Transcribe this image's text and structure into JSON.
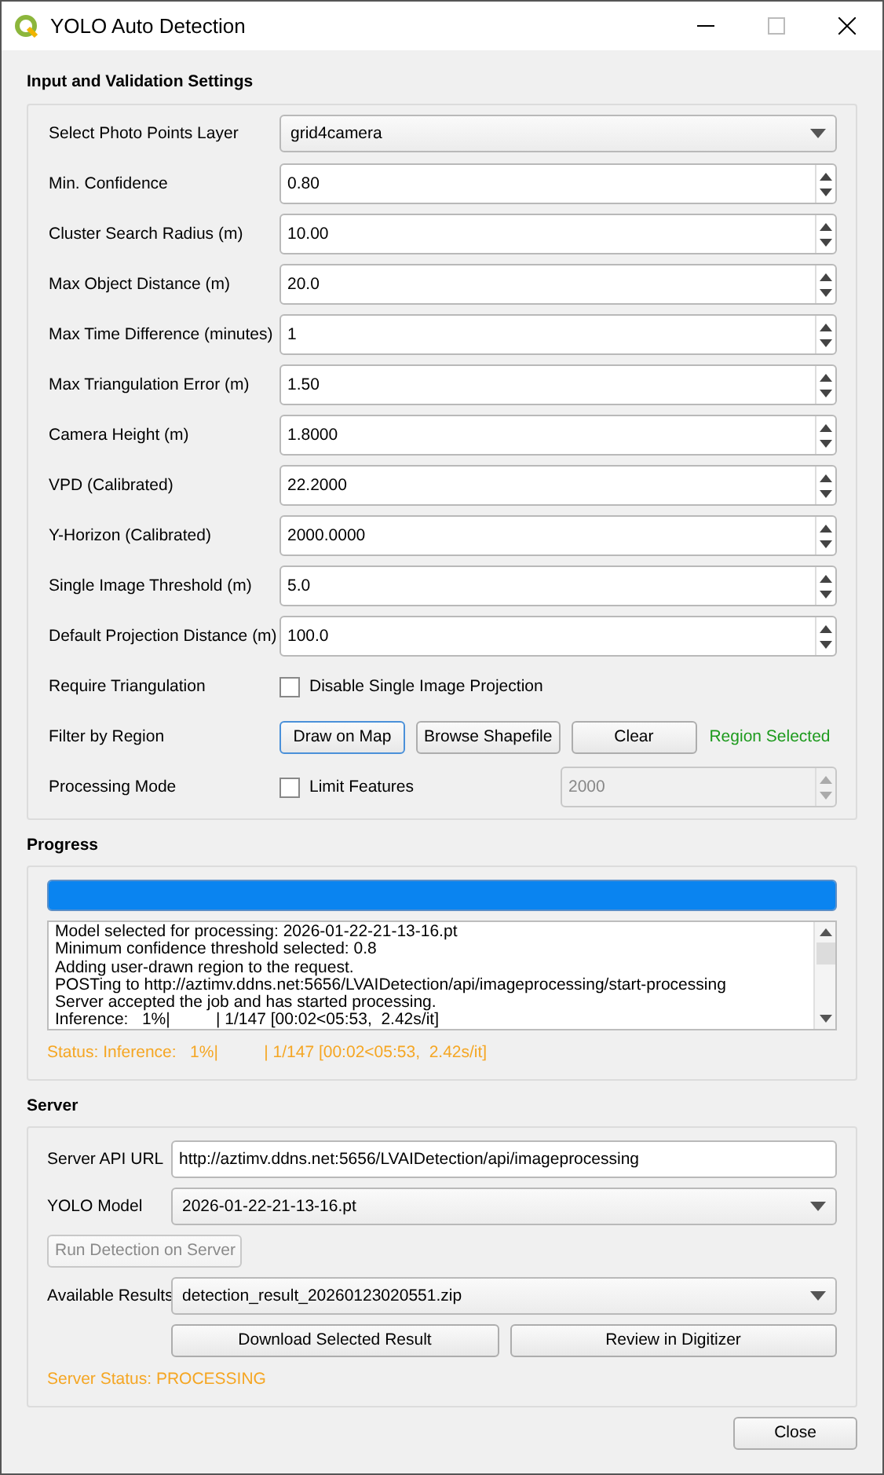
{
  "window": {
    "title": "YOLO Auto Detection"
  },
  "settings": {
    "heading": "Input and Validation Settings",
    "rows": [
      {
        "kind": "combo",
        "label": "Select Photo Points Layer",
        "value": "grid4camera"
      },
      {
        "kind": "spin",
        "label": "Min. Confidence",
        "value": "0.80"
      },
      {
        "kind": "spin",
        "label": "Cluster Search Radius (m)",
        "value": "10.00"
      },
      {
        "kind": "spin",
        "label": "Max Object Distance (m)",
        "value": "20.0"
      },
      {
        "kind": "spin",
        "label": "Max Time Difference (minutes)",
        "value": "1"
      },
      {
        "kind": "spin",
        "label": "Max Triangulation Error (m)",
        "value": "1.50"
      },
      {
        "kind": "spin",
        "label": "Camera Height (m)",
        "value": "1.8000"
      },
      {
        "kind": "spin",
        "label": "VPD (Calibrated)",
        "value": "22.2000"
      },
      {
        "kind": "spin",
        "label": "Y-Horizon (Calibrated)",
        "value": "2000.0000"
      },
      {
        "kind": "spin",
        "label": "Single Image Threshold (m)",
        "value": "5.0"
      },
      {
        "kind": "spin",
        "label": "Default Projection Distance (m)",
        "value": "100.0"
      },
      {
        "kind": "checkbox",
        "label": "Require Triangulation",
        "option": "Disable Single Image Projection",
        "checked": false
      },
      {
        "kind": "buttons",
        "label": "Filter by Region",
        "buttons": [
          {
            "label": "Draw on Map",
            "focused": true
          },
          {
            "label": "Browse Shapefile",
            "focused": false
          },
          {
            "label": "Clear",
            "focused": false
          }
        ],
        "status": "Region Selected"
      },
      {
        "kind": "limit",
        "label": "Processing Mode",
        "option": "Limit Features",
        "checked": false,
        "value": "2000",
        "disabled": true
      }
    ]
  },
  "progress": {
    "heading": "Progress",
    "level": 1,
    "log": [
      "Model selected for processing: 2026-01-22-21-13-16.pt",
      "Minimum confidence threshold selected: 0.8",
      "Adding user-drawn region to the request.",
      "POSTing to http://aztimv.ddns.net:5656/LVAIDetection/api/imageprocessing/start-processing",
      "Server accepted the job and has started processing.",
      "Inference:   1%|          | 1/147 [00:02<05:53,  2.42s/it]"
    ],
    "status": "Status: Inference:   1%|          | 1/147 [00:02<05:53,  2.42s/it]"
  },
  "server": {
    "heading": "Server",
    "url_label": "Server API URL",
    "url": "http://aztimv.ddns.net:5656/LVAIDetection/api/imageprocessing",
    "model_label": "YOLO Model",
    "model": "2026-01-22-21-13-16.pt",
    "run_button": {
      "label": "Run Detection on Server",
      "disabled": true
    },
    "results_label": "Available Results",
    "result": "detection_result_20260123020551.zip",
    "download_button": "Download Selected Result",
    "review_button": "Review in Digitizer",
    "status": "Server Status: PROCESSING"
  },
  "close_button": "Close"
}
